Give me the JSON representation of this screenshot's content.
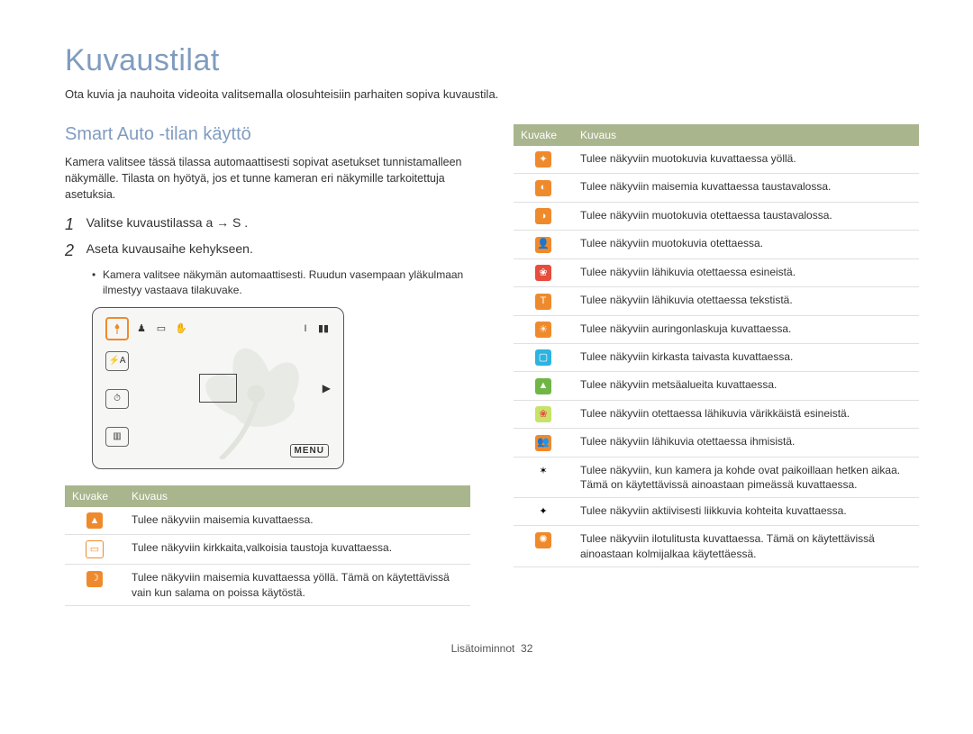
{
  "page": {
    "title": "Kuvaustilat",
    "intro": "Ota kuvia ja nauhoita videoita valitsemalla olosuhteisiin parhaiten sopiva kuvaustila."
  },
  "section": {
    "title": "Smart Auto -tilan käyttö",
    "para": "Kamera valitsee tässä tilassa automaattisesti sopivat asetukset tunnistamalleen näkymälle. Tilasta on hyötyä, jos et tunne kameran eri näkymille tarkoitettuja asetuksia.",
    "step1_num": "1",
    "step1_text_a": "Valitse kuvaustilassa ",
    "step1_arrow": "a →",
    "step1_text_b": " S .",
    "step2_num": "2",
    "step2_text": "Aseta kuvausaihe kehykseen.",
    "bullet": "Kamera valitsee näkymän automaattisesti. Ruudun vasempaan yläkulmaan ilmestyy vastaava tilakuvake."
  },
  "lcd": {
    "menu": "MENU"
  },
  "table_headers": {
    "icon": "Kuvake",
    "desc": "Kuvaus"
  },
  "left_table": [
    {
      "icon_name": "landscape-icon",
      "color": "ico-orange",
      "glyph": "▲",
      "desc": "Tulee näkyviin maisemia kuvattaessa."
    },
    {
      "icon_name": "white-bg-icon",
      "color": "ico-white",
      "glyph": "▭",
      "desc": "Tulee näkyviin kirkkaita,valkoisia taustoja kuvattaessa."
    },
    {
      "icon_name": "night-landscape-icon",
      "color": "ico-orange",
      "glyph": "☽",
      "desc": "Tulee näkyviin maisemia kuvattaessa yöllä. Tämä on käytettävissä vain kun salama on poissa käytöstä."
    }
  ],
  "right_table": [
    {
      "icon_name": "night-portrait-icon",
      "color": "ico-orange",
      "glyph": "✦",
      "desc": "Tulee näkyviin muotokuvia kuvattaessa yöllä."
    },
    {
      "icon_name": "backlit-landscape-icon",
      "color": "ico-orange",
      "glyph": "◐",
      "desc": "Tulee näkyviin maisemia kuvattaessa taustavalossa."
    },
    {
      "icon_name": "backlit-portrait-icon",
      "color": "ico-orange",
      "glyph": "◑",
      "desc": "Tulee näkyviin muotokuvia otettaessa taustavalossa."
    },
    {
      "icon_name": "portrait-icon",
      "color": "ico-orange",
      "glyph": "👤",
      "desc": "Tulee näkyviin muotokuvia otettaessa."
    },
    {
      "icon_name": "macro-object-icon",
      "color": "ico-red",
      "glyph": "❀",
      "desc": "Tulee näkyviin lähikuvia otettaessa esineistä."
    },
    {
      "icon_name": "macro-text-icon",
      "color": "ico-orange",
      "glyph": "T",
      "desc": "Tulee näkyviin lähikuvia otettaessa tekstistä."
    },
    {
      "icon_name": "sunset-icon",
      "color": "ico-orange",
      "glyph": "☀",
      "desc": "Tulee näkyviin auringonlaskuja kuvattaessa."
    },
    {
      "icon_name": "bluesky-icon",
      "color": "ico-blue",
      "glyph": "▢",
      "desc": "Tulee näkyviin kirkasta taivasta kuvattaessa."
    },
    {
      "icon_name": "forest-icon",
      "color": "ico-green",
      "glyph": "▲",
      "desc": "Tulee näkyviin metsäalueita kuvattaessa."
    },
    {
      "icon_name": "macro-color-icon",
      "color": "ico-limered",
      "glyph": "❀",
      "desc": "Tulee näkyviin otettaessa lähikuvia värikkäistä esineistä."
    },
    {
      "icon_name": "macro-people-icon",
      "color": "ico-orange",
      "glyph": "👥",
      "desc": "Tulee näkyviin lähikuvia otettaessa ihmisistä."
    },
    {
      "icon_name": "tripod-icon",
      "color": "ico-black",
      "glyph": "✶",
      "desc": "Tulee näkyviin, kun kamera ja kohde ovat paikoillaan hetken aikaa. Tämä on käytettävissä ainoastaan pimeässä kuvattaessa."
    },
    {
      "icon_name": "action-icon",
      "color": "ico-black",
      "glyph": "✦",
      "desc": "Tulee näkyviin aktiivisesti liikkuvia kohteita kuvattaessa."
    },
    {
      "icon_name": "fireworks-icon",
      "color": "ico-orange",
      "glyph": "✺",
      "desc": "Tulee näkyviin ilotulitusta kuvattaessa. Tämä on käytettävissä ainoastaan kolmijalkaa käytettäessä."
    }
  ],
  "footer": {
    "section": "Lisätoiminnot",
    "page": "32"
  }
}
